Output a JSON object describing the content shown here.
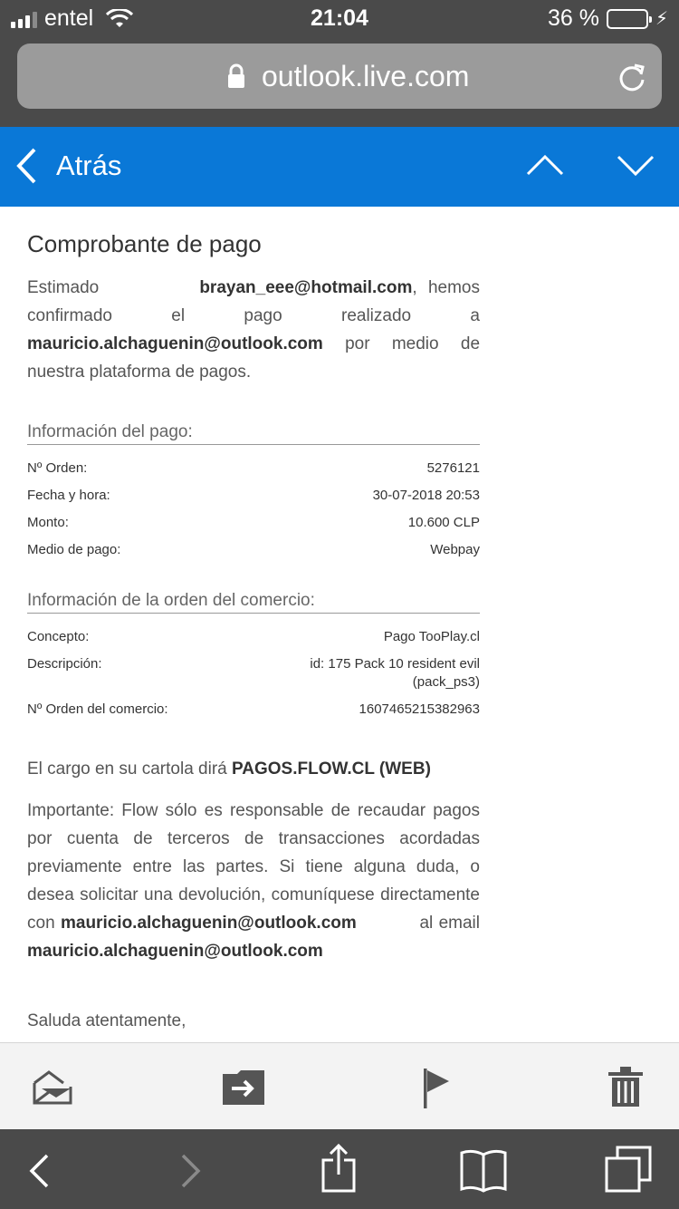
{
  "status": {
    "carrier": "entel",
    "time": "21:04",
    "battery": "36 %"
  },
  "browser": {
    "url": "outlook.live.com"
  },
  "header": {
    "back_label": "Atrás"
  },
  "email": {
    "subject": "Comprobante de pago",
    "intro": {
      "w1": "Estimado",
      "payer_email": "brayan_eee@hotmail.com",
      "w2": ", hemos confirmado el pago realizado a",
      "merchant_email": "mauricio.alchaguenin@outlook.com",
      "w3": "por medio de nuestra plataforma de pagos."
    },
    "payment_info": {
      "title": "Información del pago:",
      "rows": [
        {
          "label": "Nº Orden:",
          "value": "5276121"
        },
        {
          "label": "Fecha y hora:",
          "value": "30-07-2018 20:53"
        },
        {
          "label": "Monto:",
          "value": "10.600 CLP"
        },
        {
          "label": "Medio de pago:",
          "value": "Webpay"
        }
      ]
    },
    "order_info": {
      "title": "Información de la orden del comercio:",
      "rows": [
        {
          "label": "Concepto:",
          "value": "Pago TooPlay.cl"
        },
        {
          "label": "Descripción:",
          "value": "id: 175 Pack 10 resident evil",
          "value2": "(pack_ps3)"
        },
        {
          "label": "Nº Orden del comercio:",
          "value": "1607465215382963"
        }
      ]
    },
    "statement": {
      "text": "El cargo en su cartola dirá",
      "descriptor": "PAGOS.FLOW.CL (WEB)"
    },
    "important": {
      "text": "Importante: Flow sólo es responsable de recaudar pagos por cuenta de terceros de transacciones acordadas previamente entre las partes. Si tiene alguna duda, o desea solicitar una devolución, comuníquese directamente con",
      "email1": "mauricio.alchaguenin@outlook.com",
      "mid": "al email",
      "email2": "mauricio.alchaguenin@outlook.com"
    },
    "closing": "Saluda atentamente,"
  },
  "toolbar": {
    "icons": [
      "mark-read-icon",
      "move-icon",
      "flag-icon",
      "trash-icon"
    ]
  },
  "safari": {
    "icons": [
      "back-icon",
      "forward-icon",
      "share-icon",
      "bookmarks-icon",
      "tabs-icon"
    ]
  }
}
